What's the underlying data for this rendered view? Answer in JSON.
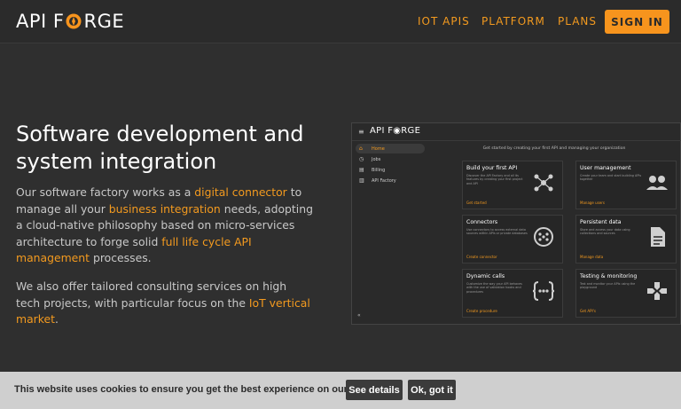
{
  "header": {
    "logo_left": "API F",
    "logo_right": "RGE",
    "nav": [
      "IOT APIS",
      "PLATFORM",
      "PLANS"
    ],
    "signin_label": "SIGN IN"
  },
  "hero": {
    "title": "Software development and system integration",
    "p1_a": "Our software factory works as a ",
    "p1_hl1": "digital connector",
    "p1_b": " to manage all your ",
    "p1_hl2": "business integration",
    "p1_c": " needs, adopting a cloud-native philosophy based on micro-services architecture to forge solid ",
    "p1_hl3": "full life cycle API management",
    "p1_d": " processes.",
    "p2_a": "We also offer tailored consulting services on high tech projects, with particular focus on the ",
    "p2_hl": "IoT vertical market",
    "p2_b": "."
  },
  "preview": {
    "menu_icon": "≡",
    "logo": "API F◉RGE",
    "sidebar": [
      {
        "label": "Home",
        "icon": "home-icon",
        "glyph": "⌂"
      },
      {
        "label": "Jobs",
        "icon": "jobs-icon",
        "glyph": "◷"
      },
      {
        "label": "Billing",
        "icon": "billing-icon",
        "glyph": "▤"
      },
      {
        "label": "API Factory",
        "icon": "api-factory-icon",
        "glyph": "▥"
      }
    ],
    "collapse": "«",
    "intro": "Get started by creating your first API and managing your organization",
    "cards": [
      {
        "title": "Build your first API",
        "desc": "Discover the API Factory and all its features by creating your first project and API",
        "link": "Get started"
      },
      {
        "title": "User management",
        "desc": "Create your team and start building APIs together",
        "link": "Manage users"
      },
      {
        "title": "Connectors",
        "desc": "Use connectors to access external data sources within APIs or private databases",
        "link": "Create connector"
      },
      {
        "title": "Persistent data",
        "desc": "Store and access your data using collections and sources",
        "link": "Manage data"
      },
      {
        "title": "Dynamic calls",
        "desc": "Customize the way your API behaves with the use of validation hooks and procedures",
        "link": "Create procedure"
      },
      {
        "title": "Testing & monitoring",
        "desc": "Test and monitor your APIs using the playground",
        "link": "Get API's"
      }
    ]
  },
  "cookie": {
    "text": "This website uses cookies to ensure you get the best experience on our platform.",
    "details_label": "See details",
    "ok_label": "Ok, got it"
  },
  "colors": {
    "accent": "#f7941d",
    "background": "#2f2f2f",
    "cookie_bar": "#cfcfcf"
  }
}
